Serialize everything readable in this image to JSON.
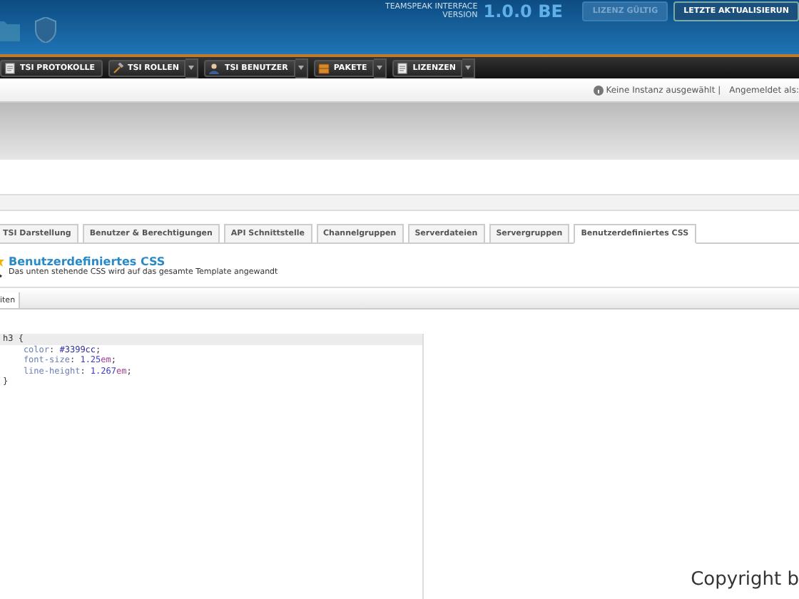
{
  "header": {
    "product": "TEAMSPEAK INTERFACE",
    "version_label": "VERSION",
    "version": "1.0.0 BE",
    "buttons": [
      {
        "label": "LIZENZ GÜLTIG",
        "disabled": true
      },
      {
        "label": "LETZTE AKTUALISIERUN",
        "disabled": false
      }
    ]
  },
  "nav": [
    {
      "label": "TSI PROTOKOLLE",
      "kind": "doc",
      "dropdown": false
    },
    {
      "label": "TSI ROLLEN",
      "kind": "hammer",
      "dropdown": true
    },
    {
      "label": "TSI BENUTZER",
      "kind": "user",
      "dropdown": true
    },
    {
      "label": "PAKETE",
      "kind": "box",
      "dropdown": true
    },
    {
      "label": "LIZENZEN",
      "kind": "doc",
      "dropdown": true
    }
  ],
  "status": {
    "instance": "Keine Instanz ausgewählt |",
    "login": "Angemeldet als:"
  },
  "tabs": [
    {
      "label": "TSI Darstellung",
      "selected": false
    },
    {
      "label": "Benutzer & Berechtigungen",
      "selected": false
    },
    {
      "label": "API Schnittstelle",
      "selected": false
    },
    {
      "label": "Channelgruppen",
      "selected": false
    },
    {
      "label": "Serverdateien",
      "selected": false
    },
    {
      "label": "Servergruppen",
      "selected": false
    },
    {
      "label": "Benutzerdefiniertes CSS",
      "selected": true
    }
  ],
  "section": {
    "title": "Benutzerdefiniertes CSS",
    "description": "Das unten stehende CSS wird auf das gesamte Template angewandt"
  },
  "subtab": {
    "label": "iten",
    "selected": true
  },
  "code": [
    [
      {
        "kind": "selector",
        "text": "h3"
      },
      {
        "kind": "punct",
        "text": " {"
      }
    ],
    [
      {
        "kind": "property",
        "text": "    color"
      },
      {
        "kind": "punct",
        "text": ": "
      },
      {
        "kind": "value",
        "text": "#3399cc"
      },
      {
        "kind": "punct",
        "text": ";"
      }
    ],
    [
      {
        "kind": "property",
        "text": "    font-size"
      },
      {
        "kind": "punct",
        "text": ": "
      },
      {
        "kind": "number",
        "text": "1.25"
      },
      {
        "kind": "unit",
        "text": "em"
      },
      {
        "kind": "punct",
        "text": ";"
      }
    ],
    [
      {
        "kind": "property",
        "text": "    line-height"
      },
      {
        "kind": "punct",
        "text": ": "
      },
      {
        "kind": "number",
        "text": "1.267"
      },
      {
        "kind": "unit",
        "text": "em"
      },
      {
        "kind": "punct",
        "text": ";"
      }
    ],
    [
      {
        "kind": "punct",
        "text": "}"
      }
    ]
  ],
  "footer": {
    "copyright": "Copyright b"
  }
}
